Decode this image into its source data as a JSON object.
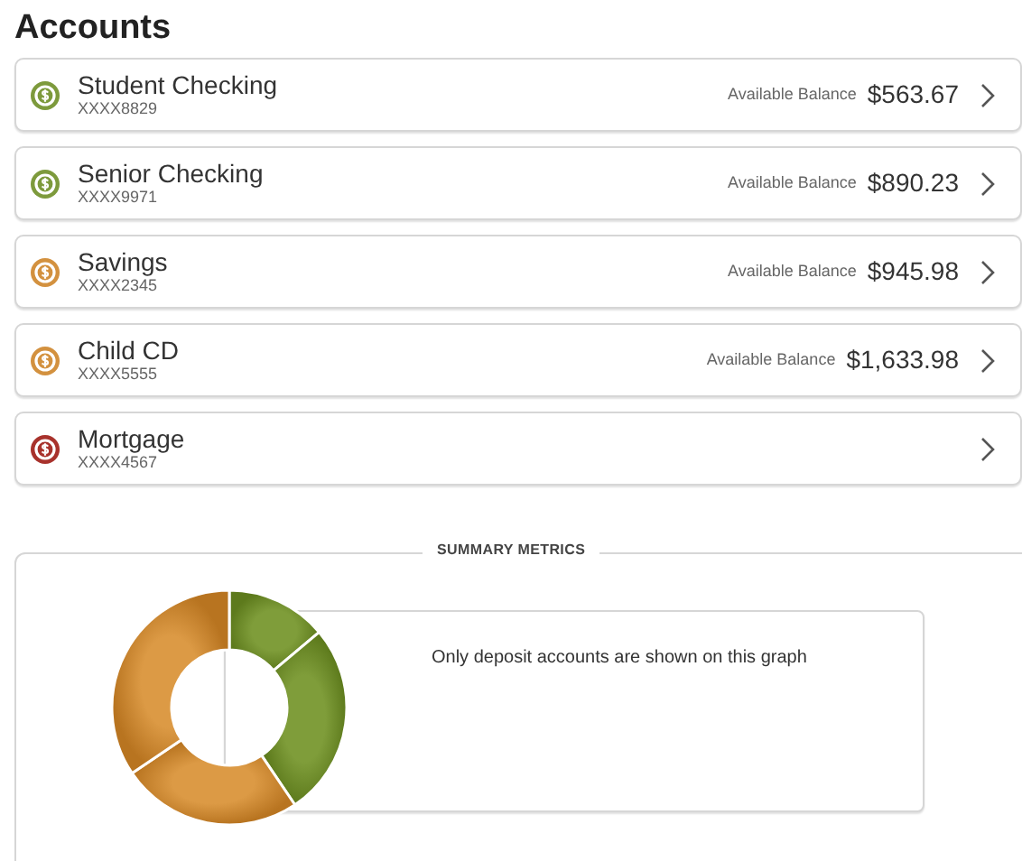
{
  "title": "Accounts",
  "accounts": [
    {
      "name": "Student Checking",
      "number": "XXXX8829",
      "balance_label": "Available Balance",
      "balance": "$563.67",
      "color": "#7d9a3c"
    },
    {
      "name": "Senior Checking",
      "number": "XXXX9971",
      "balance_label": "Available Balance",
      "balance": "$890.23",
      "color": "#7d9a3c"
    },
    {
      "name": "Savings",
      "number": "XXXX2345",
      "balance_label": "Available Balance",
      "balance": "$945.98",
      "color": "#d3913f"
    },
    {
      "name": "Child CD",
      "number": "XXXX5555",
      "balance_label": "Available Balance",
      "balance": "$1,633.98",
      "color": "#d3913f"
    },
    {
      "name": "Mortgage",
      "number": "XXXX4567",
      "color": "#a8322c"
    }
  ],
  "summary": {
    "title": "SUMMARY METRICS",
    "note": "Only deposit accounts are shown on this graph"
  }
}
